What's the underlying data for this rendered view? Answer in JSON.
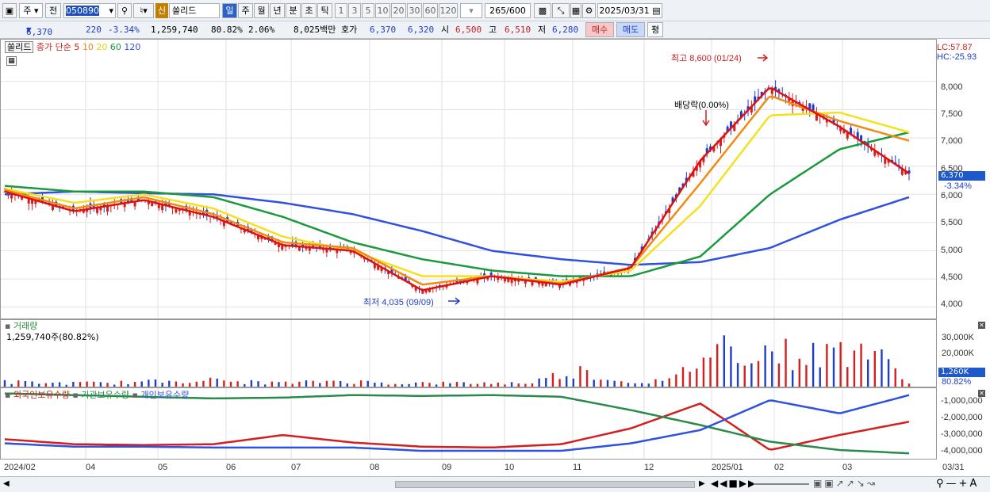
{
  "toolbar": {
    "period_btn": "주",
    "jeon_btn": "전",
    "code": "050890",
    "new_badge": "신",
    "name": "쏠리드",
    "tabs": [
      "일",
      "주",
      "월",
      "년",
      "분",
      "초",
      "틱"
    ],
    "nums": [
      "1",
      "3",
      "5",
      "10",
      "20",
      "30",
      "60",
      "120"
    ],
    "count": "265",
    "total": "/600",
    "date": "2025/03/31"
  },
  "info": {
    "price": "6,370",
    "change": "220",
    "pct": "-3.34%",
    "volume": "1,259,740",
    "vol_ratio": "80.82%",
    "turn": "2.06%",
    "amount": "8,025백만",
    "hoga_label": "호가",
    "hoga1": "6,370",
    "hoga2": "6,320",
    "open_label": "시",
    "open": "6,500",
    "high_label": "고",
    "high": "6,510",
    "low_label": "저",
    "low": "6,280",
    "buy": "매수",
    "sell": "매도",
    "eval": "평"
  },
  "price_panel": {
    "name_box": "쏠리드",
    "legend_prefix": "종가 단순",
    "ma": [
      "5",
      "10",
      "20",
      "60",
      "120"
    ],
    "lc": "LC:57.87",
    "hc": "HC:-25.93",
    "high_note": "최고 8,600 (01/24)",
    "low_note": "최저 4,035 (09/09)",
    "dividend": "배당락(0.00%)",
    "last_box": "6,370",
    "last_pct": "-3.34%",
    "yticks": [
      "8,000",
      "7,500",
      "7,000",
      "6,500",
      "6,000",
      "5,500",
      "5,000",
      "4,500",
      "4,000"
    ]
  },
  "volume_panel": {
    "title": "거래량",
    "value": "1,259,740주(80.82%)",
    "yticks": [
      "30,000K",
      "20,000K",
      "10,000K"
    ],
    "last_box": "1,260K",
    "last_pct": "80.82%"
  },
  "holding_panel": {
    "leg1": "외국인보유수량",
    "leg2": "기관보유수량",
    "leg3": "개인보유수량",
    "yticks": [
      "-1,000,000",
      "-2,000,000",
      "-3,000,000",
      "-4,000,000"
    ]
  },
  "xaxis": [
    "2024/02",
    "04",
    "05",
    "06",
    "07",
    "08",
    "09",
    "10",
    "11",
    "12",
    "2025/01",
    "02",
    "03",
    "03/31"
  ],
  "colors": {
    "up": "#d21f1f",
    "down": "#1f3ec8",
    "ma5": "#e01010",
    "ma10": "#f08a10",
    "ma20": "#f5e020",
    "ma60": "#1a9a3c",
    "ma120": "#3050e0"
  },
  "chart_data": {
    "type": "line",
    "title": "쏠리드",
    "x": [
      "2024/02",
      "2024/04",
      "2024/05",
      "2024/06",
      "2024/07",
      "2024/08",
      "2024/09",
      "2024/10",
      "2024/11",
      "2024/12",
      "2025/01",
      "2025/02",
      "2025/03",
      "2025/03/31"
    ],
    "series": [
      {
        "name": "5",
        "values": [
          6050,
          5700,
          5900,
          5600,
          5100,
          5000,
          4300,
          4550,
          4400,
          4700,
          6600,
          7900,
          7200,
          6370
        ]
      },
      {
        "name": "10",
        "values": [
          6080,
          5750,
          5950,
          5650,
          5150,
          5050,
          4400,
          4550,
          4420,
          4700,
          6200,
          7750,
          7300,
          6950
        ]
      },
      {
        "name": "20",
        "values": [
          6100,
          5850,
          6000,
          5750,
          5250,
          5000,
          4550,
          4550,
          4450,
          4650,
          5800,
          7400,
          7450,
          7100
        ]
      },
      {
        "name": "60",
        "values": [
          6150,
          6050,
          6050,
          5950,
          5600,
          5150,
          4850,
          4650,
          4550,
          4550,
          4900,
          6000,
          6800,
          7100
        ]
      },
      {
        "name": "120",
        "values": [
          6000,
          6050,
          6020,
          6000,
          5850,
          5650,
          5350,
          5000,
          4850,
          4750,
          4800,
          5050,
          5550,
          5950
        ]
      }
    ],
    "ylim": [
      3800,
      8700
    ],
    "volume_k": [
      4,
      3,
      3,
      4,
      6,
      4,
      3,
      5,
      3,
      3,
      3,
      3,
      14,
      4,
      5,
      35,
      30,
      26,
      35,
      5
    ],
    "holding": {
      "외국인보유수량": [
        -3350000,
        -3650000,
        -3700000,
        -3650000,
        -3100000,
        -3550000,
        -3800000,
        -3850000,
        -3650000,
        -2700000,
        -1200000,
        -4000000,
        -3100000,
        -2300000
      ],
      "기관보유수량": [
        -600000,
        -700000,
        -800000,
        -900000,
        -850000,
        -700000,
        -750000,
        -700000,
        -800000,
        -1600000,
        -2500000,
        -3500000,
        -4000000,
        -4200000
      ],
      "개인보유수량": [
        -3600000,
        -3800000,
        -3800000,
        -3850000,
        -3850000,
        -3850000,
        -4050000,
        -4050000,
        -4050000,
        -3600000,
        -2800000,
        -1000000,
        -1800000,
        -700000
      ]
    }
  }
}
